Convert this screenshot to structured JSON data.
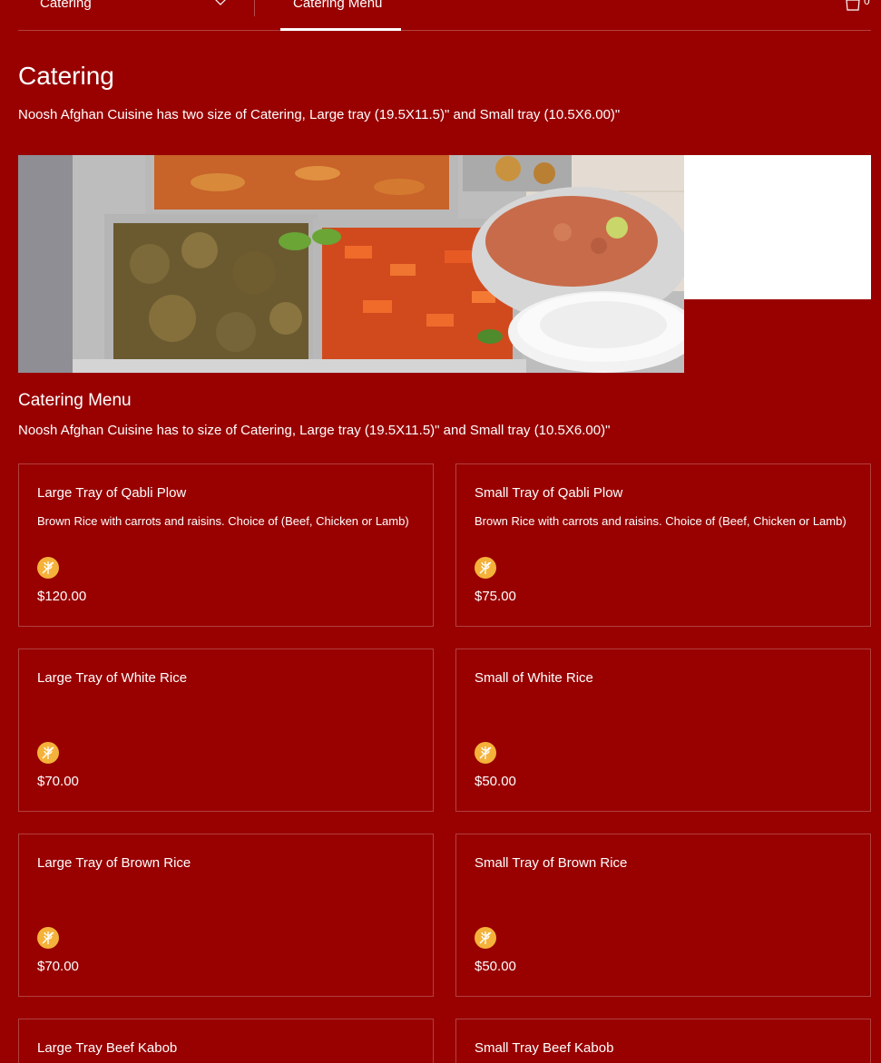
{
  "topbar": {
    "menu_select_label": "Catering",
    "tab_label": "Catering Menu",
    "cart_count": "0"
  },
  "header": {
    "title": "Catering",
    "description": "Noosh Afghan Cuisine has two size of Catering, Large tray (19.5X11.5)\" and Small tray (10.5X6.00)\""
  },
  "section": {
    "title": "Catering Menu",
    "description": "Noosh Afghan Cuisine has to size of Catering, Large tray (19.5X11.5)\" and Small tray (10.5X6.00)\""
  },
  "items": [
    {
      "name": "Large Tray of Qabli Plow",
      "description": "Brown Rice with carrots and raisins. Choice of (Beef, Chicken or Lamb)",
      "price": "$120.00",
      "badge": "gluten-free-icon"
    },
    {
      "name": "Small Tray of Qabli Plow",
      "description": "Brown Rice with carrots and raisins. Choice of (Beef, Chicken or Lamb)",
      "price": "$75.00",
      "badge": "gluten-free-icon"
    },
    {
      "name": "Large Tray of White Rice",
      "description": "",
      "price": "$70.00",
      "badge": "gluten-free-icon"
    },
    {
      "name": "Small of White Rice",
      "description": "",
      "price": "$50.00",
      "badge": "gluten-free-icon"
    },
    {
      "name": "Large Tray of Brown Rice",
      "description": "",
      "price": "$70.00",
      "badge": "gluten-free-icon"
    },
    {
      "name": "Small Tray of Brown Rice",
      "description": "",
      "price": "$50.00",
      "badge": "gluten-free-icon"
    },
    {
      "name": "Large Tray Beef Kabob",
      "description": "",
      "price": "",
      "badge": ""
    },
    {
      "name": "Small Tray Beef Kabob",
      "description": "",
      "price": "",
      "badge": ""
    }
  ],
  "colors": {
    "background": "#990000",
    "badge": "#f5b23a",
    "text": "#ffffff"
  }
}
